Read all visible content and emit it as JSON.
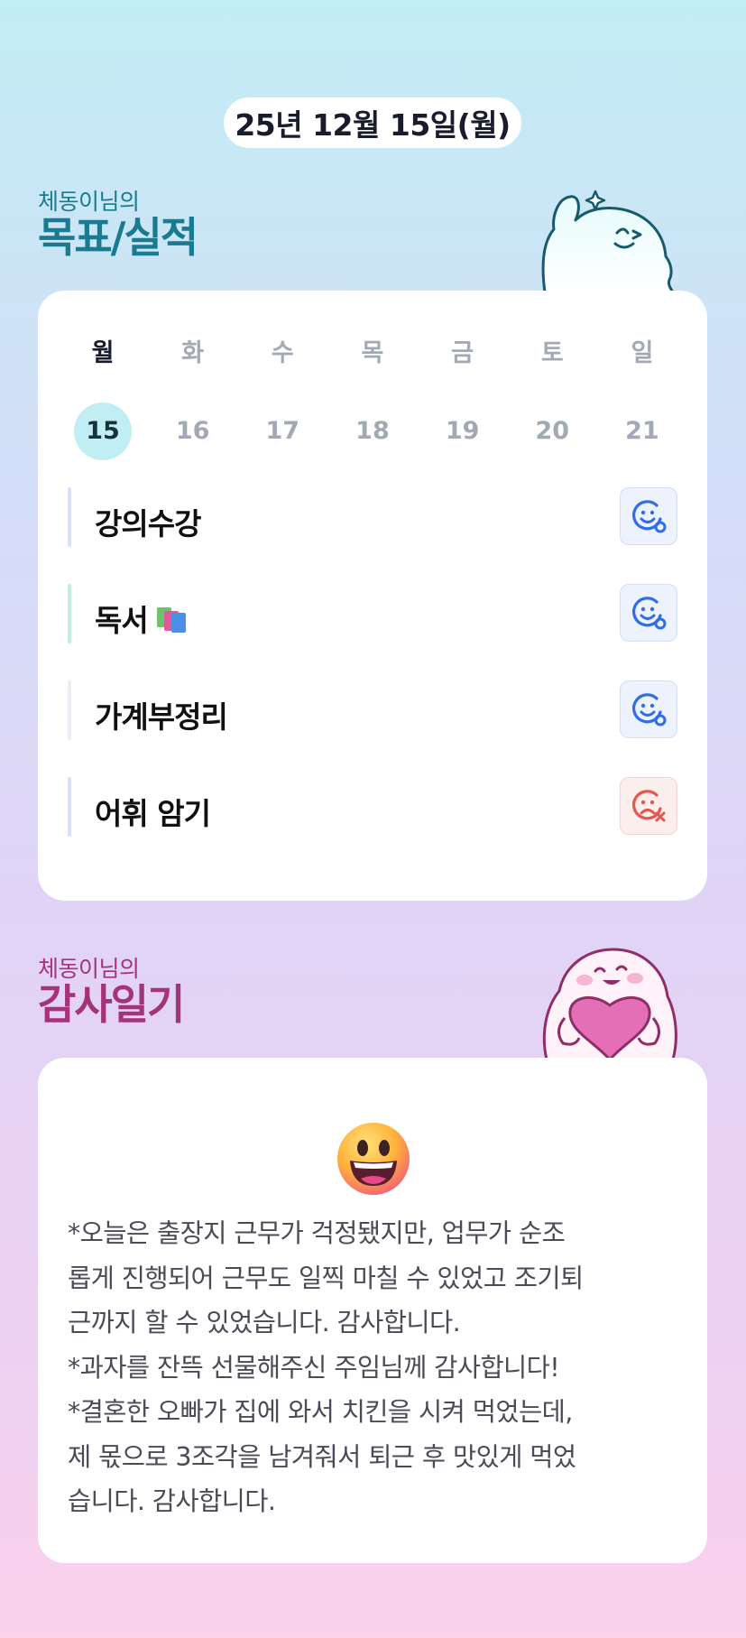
{
  "date_label": "25년 12월 15일(월)",
  "goal_section": {
    "owner_label": "체동이님의",
    "title": "목표/실적",
    "week": [
      {
        "day": "월",
        "date": "15",
        "active": true
      },
      {
        "day": "화",
        "date": "16",
        "active": false
      },
      {
        "day": "수",
        "date": "17",
        "active": false
      },
      {
        "day": "목",
        "date": "18",
        "active": false
      },
      {
        "day": "금",
        "date": "19",
        "active": false
      },
      {
        "day": "토",
        "date": "20",
        "active": false
      },
      {
        "day": "일",
        "date": "21",
        "active": false
      }
    ],
    "goals": [
      {
        "label": "강의수강",
        "bar_color": "#d6e1fb",
        "status": "achieved",
        "status_icon": "smile-check-icon"
      },
      {
        "label": "독서",
        "bar_color": "#bdf0de",
        "status": "achieved",
        "status_icon": "smile-check-icon",
        "emoji": "books-icon"
      },
      {
        "label": "가계부정리",
        "bar_color": "#eceef3",
        "status": "achieved",
        "status_icon": "smile-check-icon"
      },
      {
        "label": "어휘 암기",
        "bar_color": "#d6e1fb",
        "status": "missed",
        "status_icon": "sad-x-icon"
      }
    ]
  },
  "thanks_section": {
    "owner_label": "체동이님의",
    "title": "감사일기",
    "emoji": "grinning-face-icon",
    "lines": [
      "*오늘은 출장지 근무가 걱정됐지만, 업무가 순조",
      "롭게 진행되어 근무도 일찍 마칠 수 있었고 조기퇴",
      "근까지 할 수 있었습니다. 감사합니다.",
      "*과자를 잔뜩 선물해주신 주임님께 감사합니다!",
      "*결혼한 오빠가 집에 와서 치킨을 시켜 먹었는데,",
      "제 몫으로 3조각을 남겨줘서 퇴근 후 맛있게 먹었",
      "습니다. 감사합니다."
    ]
  },
  "colors": {
    "goal_title": "#187b8f",
    "thanks_title": "#a3347a",
    "achieved": "#2f6ee8",
    "missed": "#e5574c",
    "active_date_bg": "#c0eef3"
  }
}
